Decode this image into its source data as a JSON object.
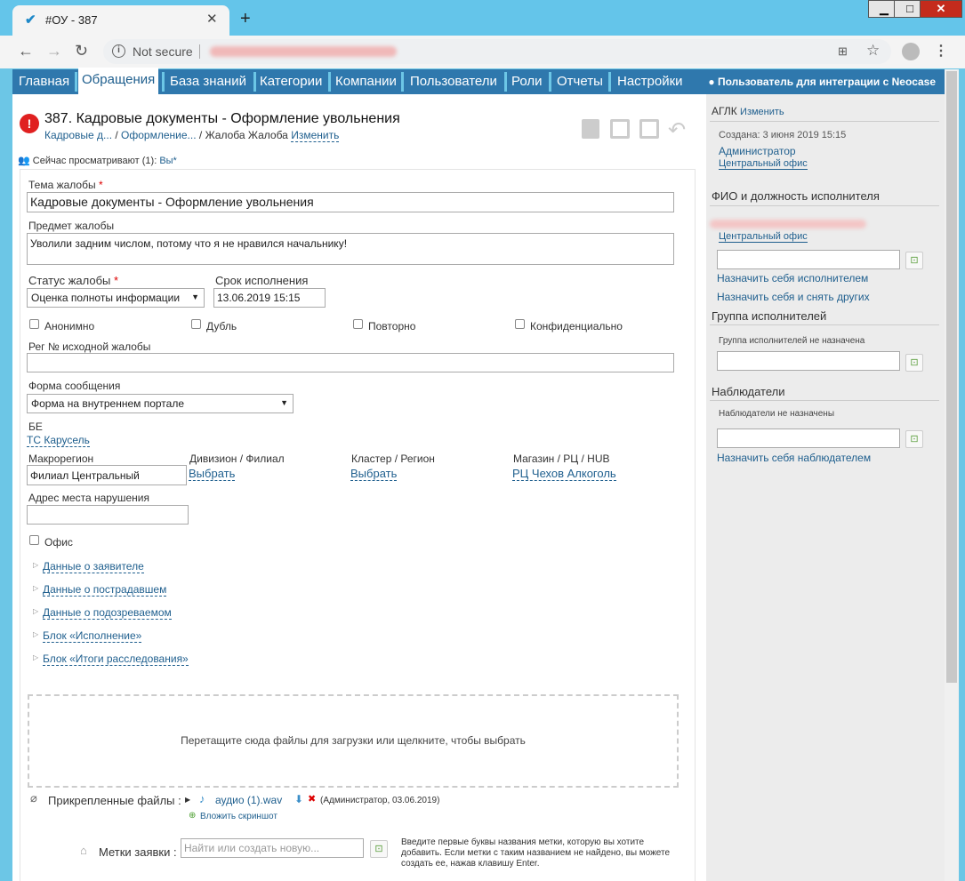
{
  "browser": {
    "tab_title": "#ОУ - 387",
    "address_text": "Not secure"
  },
  "nav": {
    "items": [
      "Главная",
      "Обращения",
      "База знаний",
      "Категории",
      "Компании",
      "Пользователи",
      "Роли",
      "Отчеты",
      "Настройки"
    ],
    "active_index": 1,
    "user": "Пользователь для интеграции с Neocase"
  },
  "ticket": {
    "title": "387. Кадровые документы - Оформление увольнения",
    "crumb1": "Кадровые д...",
    "crumb2": "Оформление...",
    "crumb3": "Жалоба Жалоба",
    "crumb_change": "Изменить",
    "viewers_label": "Сейчас просматривают (1):",
    "viewers_value": "Вы*"
  },
  "form": {
    "subject_label": "Тема жалобы",
    "subject_value": "Кадровые документы - Оформление увольнения",
    "topic_label": "Предмет жалобы",
    "topic_value": "Уволили задним числом, потому что я не нравился начальнику!",
    "status_label": "Статус жалобы",
    "status_value": "Оценка полноты информации",
    "deadline_label": "Срок исполнения",
    "deadline_value": "13.06.2019 15:15",
    "chk_anon": "Анонимно",
    "chk_dup": "Дубль",
    "chk_repeat": "Повторно",
    "chk_conf": "Конфиденциально",
    "reg_label": "Рег № исходной жалобы",
    "form_label": "Форма сообщения",
    "form_value": "Форма на внутреннем портале",
    "be_label": "БЕ",
    "be_value": "ТС Карусель",
    "macro_label": "Макрорегион",
    "macro_value": "Филиал Центральный",
    "division_label": "Дивизион / Филиал",
    "division_value": "Выбрать",
    "cluster_label": "Кластер / Регион",
    "cluster_value": "Выбрать",
    "store_label": "Магазин / РЦ / HUB",
    "store_value": "РЦ Чехов Алкоголь",
    "address_label": "Адрес места нарушения",
    "office_label": "Офис",
    "sections": [
      "Данные о заявителе",
      "Данные о пострадавшем",
      "Данные о подозреваемом",
      "Блок «Исполнение»",
      "Блок «Итоги расследования»"
    ],
    "dropzone": "Перетащите сюда файлы для загрузки или щелкните, чтобы выбрать",
    "attached_label": "Прикрепленные файлы :",
    "file_name": "аудио (1).wav",
    "file_meta": "(Администратор, 03.06.2019)",
    "screenshot_link": "Вложить скриншот",
    "tags_label": "Метки заявки :",
    "tags_placeholder": "Найти или создать новую...",
    "tags_hint": "Введите первые буквы названия метки, которую вы хотите добавить. Если метки с таким названием не найдено, вы можете создать ее, нажав клавишу Enter."
  },
  "right": {
    "org": "АГЛК",
    "org_change": "Изменить",
    "created": "Создана: 3 июня 2019 15:15",
    "creator": "Администратор",
    "creator_office": "Центральный офис",
    "executor_title": "ФИО и должность исполнителя",
    "executor_office": "Центральный офис",
    "assign_me": "Назначить себя исполнителем",
    "assign_me_remove": "Назначить себя и снять других",
    "group_title": "Группа исполнителей",
    "group_empty": "Группа исполнителей не назначена",
    "observers_title": "Наблюдатели",
    "observers_empty": "Наблюдатели не назначены",
    "assign_observer": "Назначить себя наблюдателем"
  }
}
